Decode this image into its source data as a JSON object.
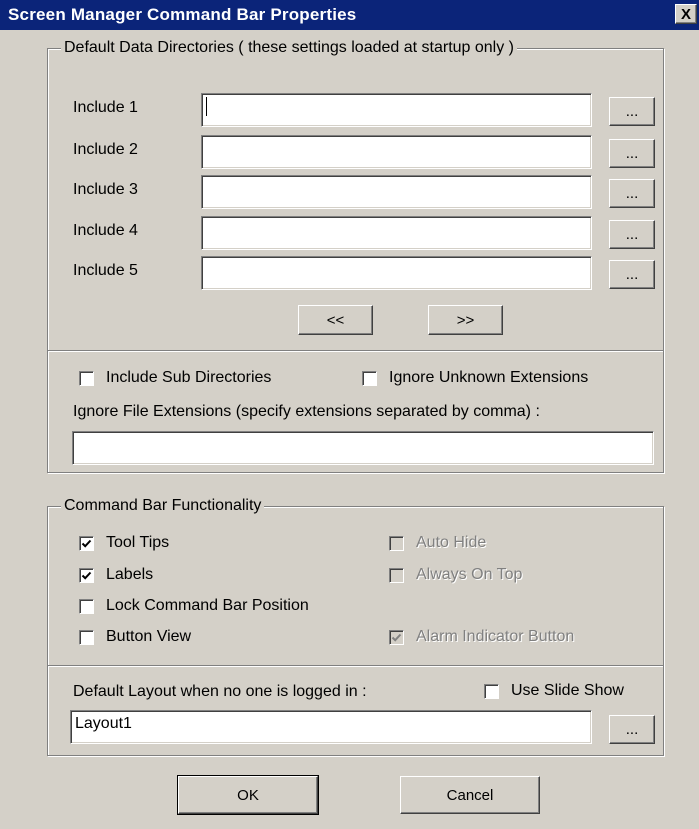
{
  "window": {
    "title": "Screen Manager Command Bar Properties",
    "close_label": "X"
  },
  "dirs": {
    "legend": "Default Data Directories  ( these settings loaded at startup only )",
    "includes": [
      {
        "label": "Include 1",
        "value": ""
      },
      {
        "label": "Include 2",
        "value": ""
      },
      {
        "label": "Include 3",
        "value": ""
      },
      {
        "label": "Include 4",
        "value": ""
      },
      {
        "label": "Include 5",
        "value": ""
      }
    ],
    "browse_label": "...",
    "prev_label": "<<",
    "next_label": ">>",
    "include_sub_dirs_label": "Include Sub Directories",
    "include_sub_dirs_checked": false,
    "ignore_unknown_label": "Ignore Unknown Extensions",
    "ignore_unknown_checked": false,
    "ignore_ext_label": "Ignore File Extensions (specify extensions separated by comma) :",
    "ignore_ext_value": ""
  },
  "functionality": {
    "legend": "Command Bar Functionality",
    "tool_tips": {
      "label": "Tool Tips",
      "checked": true,
      "enabled": true
    },
    "labels": {
      "label": "Labels",
      "checked": true,
      "enabled": true
    },
    "lock_position": {
      "label": "Lock Command Bar Position",
      "checked": false,
      "enabled": true
    },
    "button_view": {
      "label": "Button View",
      "checked": false,
      "enabled": true
    },
    "auto_hide": {
      "label": "Auto Hide",
      "checked": false,
      "enabled": false
    },
    "always_on_top": {
      "label": "Always On Top",
      "checked": false,
      "enabled": false
    },
    "alarm_indicator": {
      "label": "Alarm Indicator Button",
      "checked": true,
      "enabled": false
    },
    "default_layout_label": "Default Layout when no one is logged in :",
    "slide_show_label": "Use Slide Show",
    "slide_show_checked": false,
    "layout_value": "Layout1",
    "browse_label": "..."
  },
  "footer": {
    "ok_label": "OK",
    "cancel_label": "Cancel"
  }
}
